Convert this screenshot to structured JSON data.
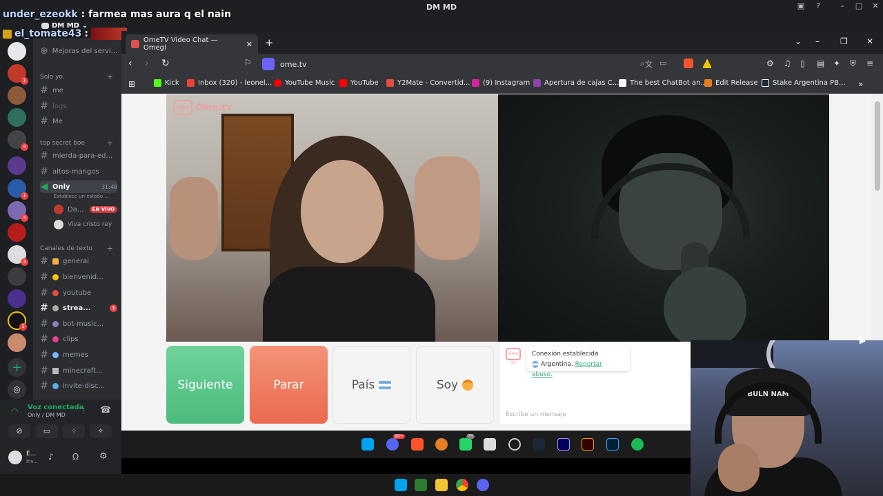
{
  "window": {
    "title": "DM MD"
  },
  "stream_chat": [
    {
      "user": "under_ezeokk",
      "message": "farmea mas aura q el nain"
    },
    {
      "user": "el_tomate43",
      "message": ":"
    }
  ],
  "discord": {
    "server_name": "DM MD",
    "server_badges": [
      "1",
      "",
      "",
      "",
      "4",
      "",
      "1",
      "4",
      "",
      "2",
      "",
      "",
      "",
      "3",
      ""
    ],
    "channels": {
      "top_item": "Mejoras del servi...",
      "section_solo": "Solo yo.",
      "solo": [
        "me",
        "logs",
        "Me"
      ],
      "section_secret": "top secret boe",
      "secret": [
        "mierda-para-ed...",
        "altos-mangos"
      ],
      "voice_channel": "Only",
      "voice_time": "31:48",
      "voice_status": "Establece un estado ...",
      "voice_users": [
        {
          "name": "Da...",
          "badge": "EN VIVO"
        },
        {
          "name": "Viva cristo rey"
        }
      ],
      "section_text": "Canales de texto",
      "text": [
        "general",
        "bienvenid...",
        "youtube",
        "strea...",
        "bot-music...",
        "clips",
        "memes",
        "minecraft...",
        "invite-disc..."
      ],
      "stream_badge": "1"
    },
    "voice": {
      "status": "Voz conectada",
      "location": "Only / DM MD"
    },
    "user": {
      "name": "E...",
      "status": "Inv..."
    }
  },
  "browser": {
    "tab_title": "OmeTV Video Chat — Omegl",
    "url": "ome.tv",
    "bookmarks": [
      {
        "label": "Kick",
        "color": "#53fc18"
      },
      {
        "label": "Inbox (320) - leonel...",
        "color": "#ea4335"
      },
      {
        "label": "YouTube Music",
        "color": "#ff0000"
      },
      {
        "label": "YouTube",
        "color": "#ff0000"
      },
      {
        "label": "Y2Mate - Convertid...",
        "color": "#e74c3c"
      },
      {
        "label": "(9) Instagram",
        "color": "#d6249f"
      },
      {
        "label": "Apertura de cajas C...",
        "color": "#8e44ad"
      },
      {
        "label": "The best ChatBot an...",
        "color": "#ffffff"
      },
      {
        "label": "Edit Release",
        "color": "#e67e22"
      },
      {
        "label": "Stake Argentina PB...",
        "color": "#1a2c38"
      }
    ]
  },
  "ometv": {
    "logo": "Ome.tv",
    "logo_small": "Ome TV",
    "btn_next": "Siguiente",
    "btn_stop": "Parar",
    "btn_country": "País",
    "btn_gender": "Soy",
    "chat_status": "Conexión establecida",
    "chat_country": "Argentina.",
    "chat_report": "Reportar abuso.",
    "chat_placeholder": "Escribe un mensaje"
  },
  "taskbar": {
    "discord_badge": "99+",
    "whatsapp_badge": "75"
  },
  "webcam": {
    "beanie_text": "BULN NAM"
  }
}
